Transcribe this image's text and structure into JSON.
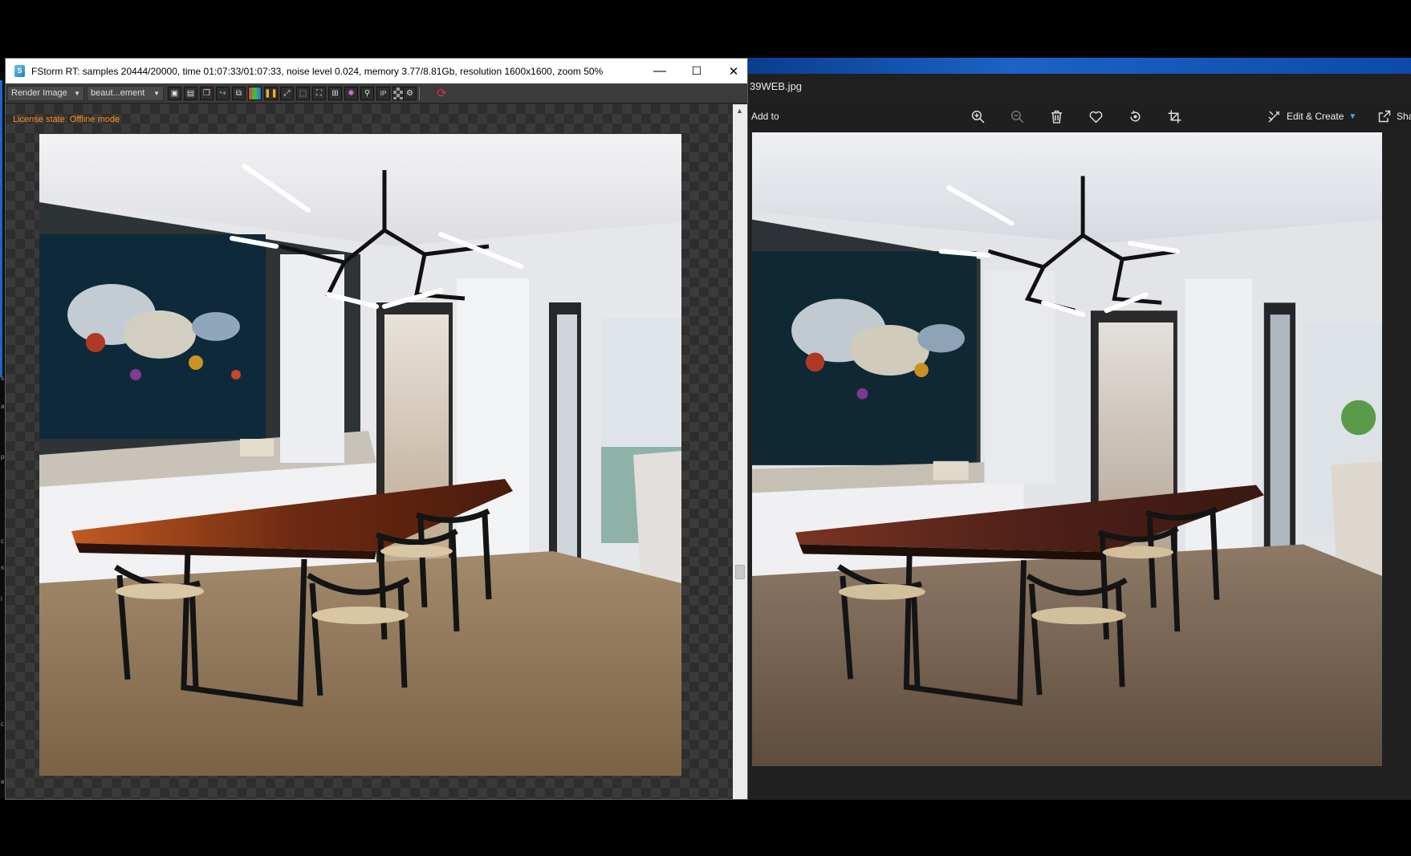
{
  "fstorm": {
    "title": "FStorm RT: samples 20444/20000,  time 01:07:33/01:07:33,  noise level 0.024,  memory 3.77/8.81Gb,  resolution 1600x1600,  zoom 50%",
    "app_icon": "fstorm-logo-icon",
    "controls": {
      "minimize": "—",
      "maximize": "☐",
      "close": "✕"
    },
    "toolbar": {
      "render_mode": "Render Image",
      "render_element": "beaut...ement",
      "icons": [
        "save-render-icon",
        "save-all-icon",
        "copy-icon",
        "export-icon",
        "clone-icon",
        "color-correction-icon",
        "pause-icon",
        "fit-icon",
        "crop-icon",
        "region-icon",
        "expand-icon",
        "lens-effects-icon",
        "color-picker-icon",
        "ip-icon",
        "alpha-checker-icon",
        "settings-icon"
      ],
      "refresh_icon": "refresh-icon"
    },
    "license_text": "License state: Offline mode"
  },
  "photos": {
    "filename": "39WEB.jpg",
    "add_to": "Add to",
    "toolbar_icons": [
      "zoom-in-icon",
      "zoom-out-icon",
      "delete-icon",
      "favorite-icon",
      "rotate-icon",
      "crop-icon"
    ],
    "edit_create": "Edit & Create",
    "share": "Sha"
  },
  "colors": {
    "license_orange": "#ff8c1a",
    "photos_bg": "#202020",
    "fstorm_toolbar": "#3b3b3b",
    "accent_blue": "#1d66c9"
  }
}
